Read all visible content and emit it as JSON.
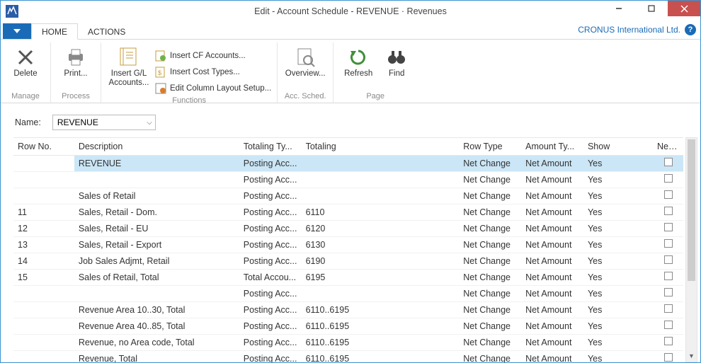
{
  "window": {
    "title": "Edit - Account Schedule - REVENUE · Revenues",
    "company": "CRONUS International Ltd."
  },
  "tabs": {
    "home": "HOME",
    "actions": "ACTIONS"
  },
  "ribbon": {
    "manage": {
      "label": "Manage",
      "delete": "Delete"
    },
    "process": {
      "label": "Process",
      "print": "Print..."
    },
    "functions": {
      "label": "Functions",
      "insert_gl": "Insert G/L Accounts...",
      "insert_cf": "Insert CF Accounts...",
      "insert_cost": "Insert Cost Types...",
      "edit_col": "Edit Column Layout Setup..."
    },
    "accsched": {
      "label": "Acc. Sched.",
      "overview": "Overview..."
    },
    "page": {
      "label": "Page",
      "refresh": "Refresh",
      "find": "Find"
    }
  },
  "form": {
    "name_label": "Name:",
    "name_value": "REVENUE"
  },
  "grid": {
    "headers": {
      "row_no": "Row No.",
      "description": "Description",
      "totaling_type": "Totaling Ty...",
      "totaling": "Totaling",
      "row_type": "Row Type",
      "amount_type": "Amount Ty...",
      "show": "Show",
      "new_page": "New..."
    },
    "rows": [
      {
        "row_no": "",
        "description": "REVENUE",
        "totaling_type": "Posting Acc...",
        "totaling": "",
        "row_type": "Net Change",
        "amount_type": "Net Amount",
        "show": "Yes",
        "new_page": false,
        "selected": true
      },
      {
        "row_no": "",
        "description": "",
        "totaling_type": "Posting Acc...",
        "totaling": "",
        "row_type": "Net Change",
        "amount_type": "Net Amount",
        "show": "Yes",
        "new_page": false
      },
      {
        "row_no": "",
        "description": "Sales of Retail",
        "totaling_type": "Posting Acc...",
        "totaling": "",
        "row_type": "Net Change",
        "amount_type": "Net Amount",
        "show": "Yes",
        "new_page": false
      },
      {
        "row_no": "11",
        "description": "Sales, Retail - Dom.",
        "totaling_type": "Posting Acc...",
        "totaling": "6110",
        "row_type": "Net Change",
        "amount_type": "Net Amount",
        "show": "Yes",
        "new_page": false
      },
      {
        "row_no": "12",
        "description": "Sales, Retail - EU",
        "totaling_type": "Posting Acc...",
        "totaling": "6120",
        "row_type": "Net Change",
        "amount_type": "Net Amount",
        "show": "Yes",
        "new_page": false
      },
      {
        "row_no": "13",
        "description": "Sales, Retail - Export",
        "totaling_type": "Posting Acc...",
        "totaling": "6130",
        "row_type": "Net Change",
        "amount_type": "Net Amount",
        "show": "Yes",
        "new_page": false
      },
      {
        "row_no": "14",
        "description": "Job Sales Adjmt, Retail",
        "totaling_type": "Posting Acc...",
        "totaling": "6190",
        "row_type": "Net Change",
        "amount_type": "Net Amount",
        "show": "Yes",
        "new_page": false
      },
      {
        "row_no": "15",
        "description": "Sales of Retail, Total",
        "totaling_type": "Total Accou...",
        "totaling": "6195",
        "row_type": "Net Change",
        "amount_type": "Net Amount",
        "show": "Yes",
        "new_page": false
      },
      {
        "row_no": "",
        "description": "",
        "totaling_type": "Posting Acc...",
        "totaling": "",
        "row_type": "Net Change",
        "amount_type": "Net Amount",
        "show": "Yes",
        "new_page": false
      },
      {
        "row_no": "",
        "description": "Revenue Area 10..30, Total",
        "totaling_type": "Posting Acc...",
        "totaling": "6110..6195",
        "row_type": "Net Change",
        "amount_type": "Net Amount",
        "show": "Yes",
        "new_page": false
      },
      {
        "row_no": "",
        "description": "Revenue Area 40..85, Total",
        "totaling_type": "Posting Acc...",
        "totaling": "6110..6195",
        "row_type": "Net Change",
        "amount_type": "Net Amount",
        "show": "Yes",
        "new_page": false
      },
      {
        "row_no": "",
        "description": "Revenue, no Area code, Total",
        "totaling_type": "Posting Acc...",
        "totaling": "6110..6195",
        "row_type": "Net Change",
        "amount_type": "Net Amount",
        "show": "Yes",
        "new_page": false
      },
      {
        "row_no": "",
        "description": "Revenue, Total",
        "totaling_type": "Posting Acc...",
        "totaling": "6110..6195",
        "row_type": "Net Change",
        "amount_type": "Net Amount",
        "show": "Yes",
        "new_page": false
      }
    ]
  }
}
